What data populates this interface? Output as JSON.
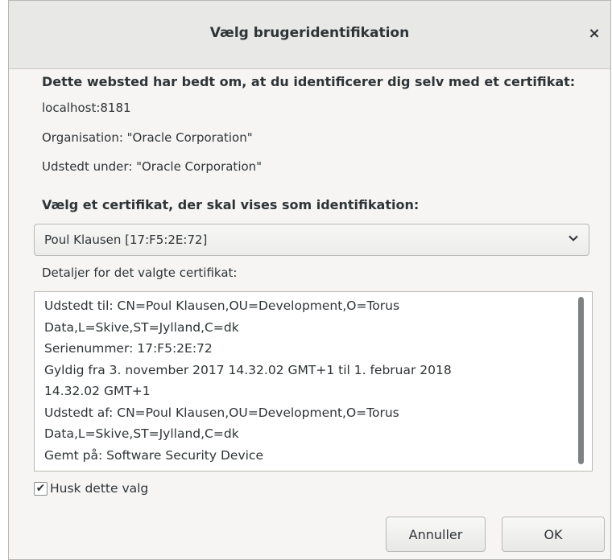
{
  "dialog": {
    "title": "Vælg brugeridentifikation",
    "close_glyph": "×"
  },
  "info": {
    "heading": "Dette websted har bedt om, at du identificerer dig selv med et certifikat:",
    "host": "localhost:8181",
    "organisation": "Organisation: \"Oracle Corporation\"",
    "issued_under": "Udstedt under: \"Oracle Corporation\""
  },
  "select": {
    "label": "Vælg et certifikat, der skal vises som identifikation:",
    "value": "Poul Klausen [17:F5:2E:72]",
    "icon": "chevron-down-icon"
  },
  "details": {
    "label": "Detaljer for det valgte certifikat:",
    "text": "Udstedt til: CN=Poul Klausen,OU=Development,O=Torus\nData,L=Skive,ST=Jylland,C=dk\nSerienummer: 17:F5:2E:72\nGyldig fra 3. november 2017 14.32.02 GMT+1 til 1. februar 2018\n14.32.02 GMT+1\nUdstedt af: CN=Poul Klausen,OU=Development,O=Torus\nData,L=Skive,ST=Jylland,C=dk\nGemt på: Software Security Device"
  },
  "remember": {
    "label": "Husk dette valg",
    "checked": true,
    "check_glyph": "✔"
  },
  "buttons": {
    "cancel": "Annuller",
    "ok": "OK"
  }
}
